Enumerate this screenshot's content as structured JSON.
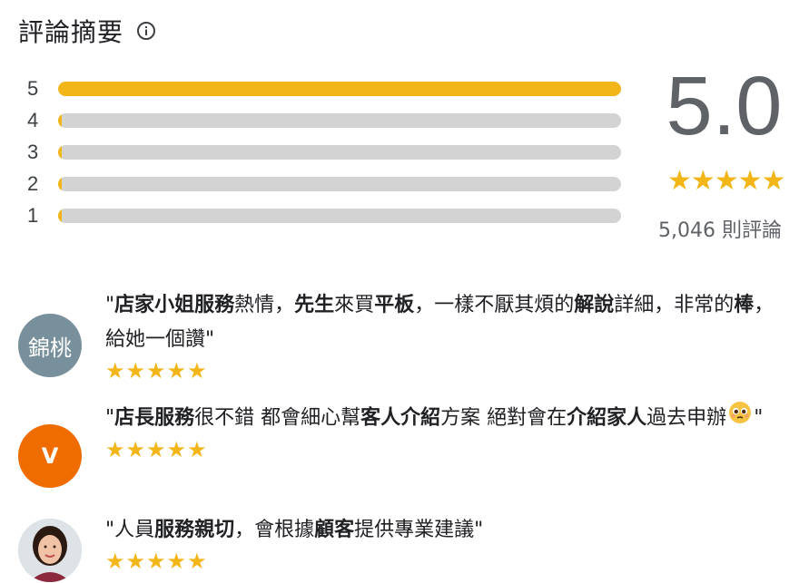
{
  "header": {
    "title": "評論摘要",
    "info_icon": "info-icon"
  },
  "colors": {
    "star": "#f2b619",
    "track": "#d3d3d3",
    "avatar1": "#78909c",
    "avatar2": "#ef6c00"
  },
  "rating_bars": [
    {
      "label": "5",
      "fraction": 1.0
    },
    {
      "label": "4",
      "fraction": 0.01
    },
    {
      "label": "3",
      "fraction": 0.01
    },
    {
      "label": "2",
      "fraction": 0.01
    },
    {
      "label": "1",
      "fraction": 0.01
    }
  ],
  "summary": {
    "score": "5.0",
    "stars": "★★★★★",
    "review_count": "5,046 則評論"
  },
  "reviews": [
    {
      "avatar_text": "錦桃",
      "stars": "★★★★★",
      "text_parts": [
        "\"",
        "店家小姐服務",
        "熱情，",
        "先生",
        "來買",
        "平板",
        "，一樣不厭其煩的",
        "解說",
        "詳細，非常的",
        "棒",
        "，給她一個讚\""
      ]
    },
    {
      "avatar_text": "V",
      "stars": "★★★★★",
      "text_parts": [
        "\"",
        "店長服務",
        "很不錯 都會細心幫",
        "客人介紹",
        "方案 絕對會在",
        "介紹家人",
        "過去申辦",
        "\""
      ],
      "emoji": "pleading-face-emoji"
    },
    {
      "avatar_text": "",
      "stars": "★★★★★",
      "text_parts": [
        "\"人員",
        "服務親切",
        "，會根據",
        "顧客",
        "提供專業建議\""
      ]
    }
  ]
}
